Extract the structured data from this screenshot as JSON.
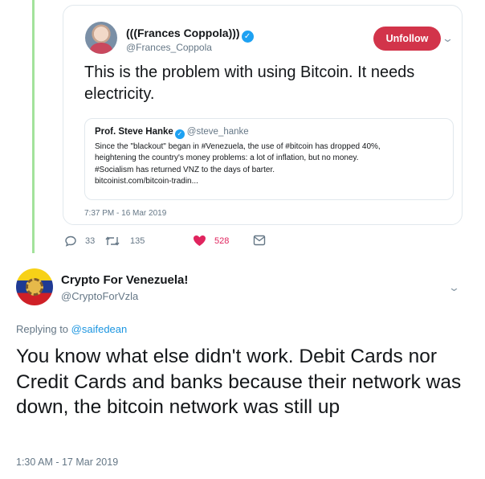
{
  "quoted_tweet": {
    "name": "(((Frances Coppola)))",
    "handle": "@Frances_Coppola",
    "follow_button": "Unfollow",
    "text": "This is the problem with using Bitcoin. It needs electricity.",
    "embedded": {
      "name": "Prof. Steve Hanke",
      "handle": "@steve_hanke",
      "body": "Since the \"blackout\" began in #Venezuela, the use of #bitcoin has dropped 40%,\nheightening the country's money problems: a lot of inflation, but no money.\n#Socialism has returned VNZ to the days of barter.\nbitcoinist.com/bitcoin-tradin..."
    },
    "timestamp": "7:37 PM - 16 Mar 2019",
    "actions": {
      "replies": "33",
      "retweets": "135",
      "likes": "528"
    },
    "colors": {
      "unfollow": "#d2344a",
      "like": "#e0245e",
      "thread_line": "#a3e29b"
    }
  },
  "reply_tweet": {
    "name": "Crypto For Venezuela!",
    "handle": "@CryptoForVzla",
    "replying_prefix": "Replying to",
    "replying_to": "@saifedean",
    "text": "You know what else didn't work. Debit Cards nor Credit Cards and banks because their network was down, the bitcoin network was still up",
    "timestamp": "1:30 AM - 17 Mar 2019"
  },
  "icons": [
    "verified-icon",
    "chevron-down-icon",
    "reply-icon",
    "retweet-icon",
    "heart-icon",
    "message-icon"
  ]
}
